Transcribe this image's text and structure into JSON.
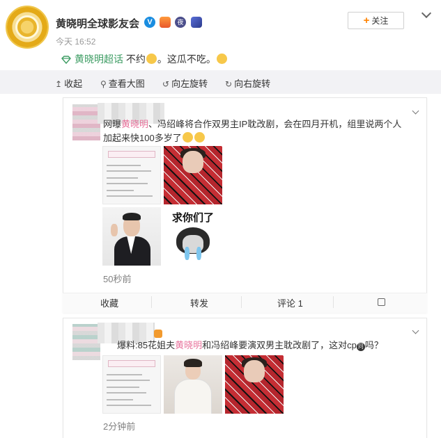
{
  "post": {
    "username": "黄晓明全球影友会",
    "time": "今天 16:52",
    "follow_label": "关注",
    "topic": "黄晓明超话",
    "text_before": " 不约",
    "text_after": "。这瓜不吃。"
  },
  "toolbar": {
    "collapse": "收起",
    "view_large": "查看大图",
    "rotate_left": "向左旋转",
    "rotate_right": "向右旋转"
  },
  "comment1": {
    "line1_a": "网曝",
    "line1_name": "黄晓明",
    "line1_b": "、冯绍峰将合作双男主IP耽改剧，会在四月开机，组里说两个人",
    "line2": "加起来快100多岁了",
    "meme_caption": "求你们了",
    "time": "50秒前",
    "actions": {
      "collect": "收藏",
      "repost": "转发",
      "comment": "评论 1"
    }
  },
  "comment2": {
    "text_a": "爆料:85花姐夫",
    "text_name": "黄晓明",
    "text_b": "和冯绍峰要演双男主耽改剧了，这对cp",
    "text_c": "吗？",
    "time": "2分钟前"
  },
  "colors": {
    "accent_orange": "#ff8200",
    "topic_green": "#3d9c63",
    "name_pink": "#e8739c"
  }
}
